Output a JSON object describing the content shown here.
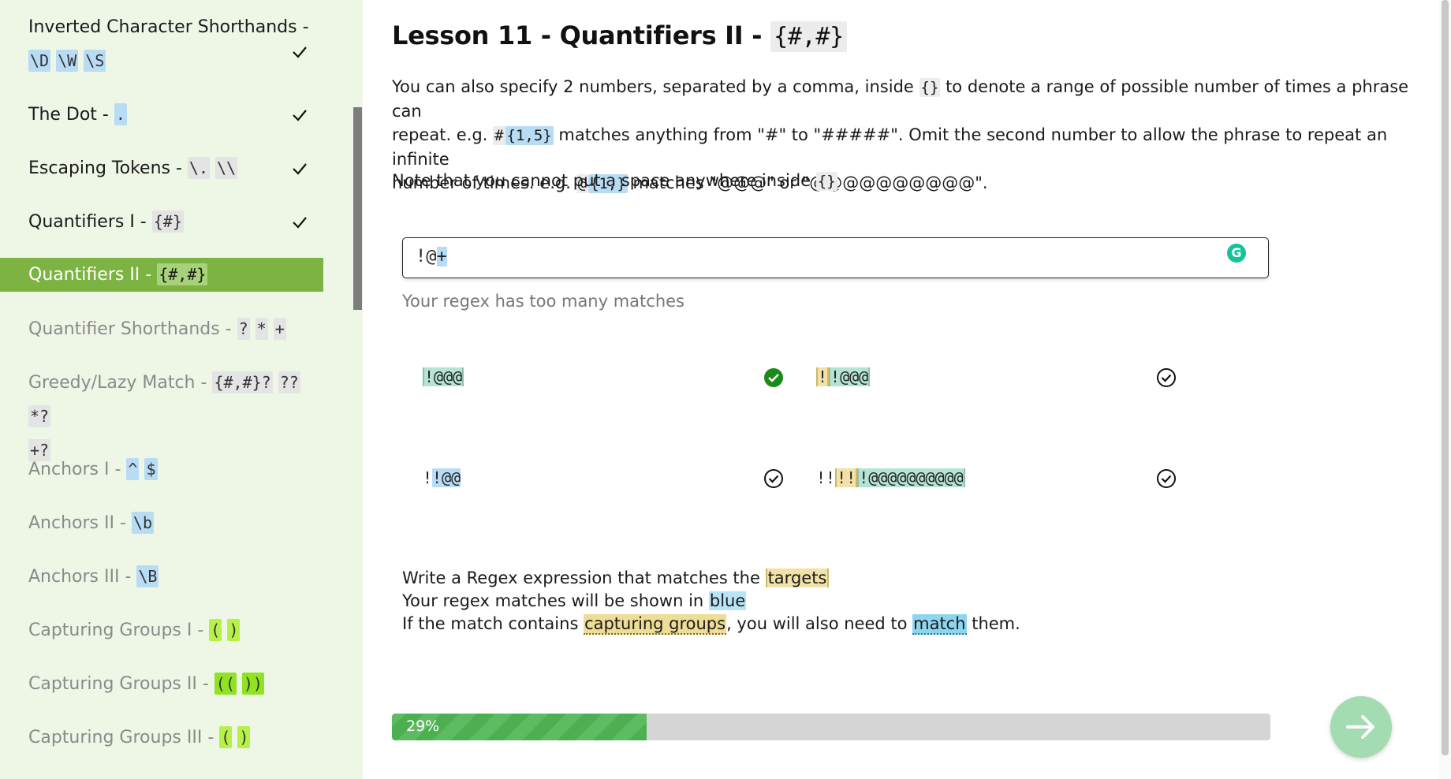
{
  "sidebar": {
    "lessons": [
      {
        "label": "Inverted Character Shorthands - ",
        "codes": [
          "\\D",
          "\\W",
          "\\S"
        ],
        "status": "done"
      },
      {
        "label": "The Dot - ",
        "codes": [
          "."
        ],
        "status": "done"
      },
      {
        "label": "Escaping Tokens - ",
        "codes": [
          "\\.",
          "\\\\"
        ],
        "status": "done"
      },
      {
        "label": "Quantifiers I - ",
        "codes": [
          "{#}"
        ],
        "status": "done"
      },
      {
        "label": "Quantifiers II - ",
        "codes": [
          "{#,#}"
        ],
        "status": "active"
      },
      {
        "label": "Quantifier Shorthands - ",
        "codes": [
          "?",
          "*",
          "+"
        ],
        "status": "todo"
      },
      {
        "label": "Greedy/Lazy Match - ",
        "codes": [
          "{#,#}?",
          "??",
          "*?",
          "+?"
        ],
        "status": "todo"
      },
      {
        "label": "Anchors I - ",
        "codes": [
          "^",
          "$"
        ],
        "status": "todo"
      },
      {
        "label": "Anchors II - ",
        "codes": [
          "\\b"
        ],
        "status": "todo"
      },
      {
        "label": "Anchors III - ",
        "codes": [
          "\\B"
        ],
        "status": "todo"
      },
      {
        "label": "Capturing Groups I - ",
        "codes": [
          "(",
          ")"
        ],
        "status": "todo"
      },
      {
        "label": "Capturing Groups II - ",
        "codes": [
          "((",
          "))"
        ],
        "status": "todo"
      },
      {
        "label": "Capturing Groups III - ",
        "codes": [
          "(",
          ")"
        ],
        "status": "todo"
      }
    ]
  },
  "lesson": {
    "title": "Lesson 11 - Quantifiers II - ",
    "title_code": "{#,#}",
    "para1": {
      "t1": "You can also specify 2 numbers, separated by a comma, inside ",
      "c1": "{}",
      "t2": " to denote a range of possible number of times a phrase can",
      "t3": "repeat. e.g. ",
      "c2a": "#",
      "c2b": "{1,5}",
      "t4": " matches anything from \"#\" to \"#####\". Omit the second number to allow the phrase to repeat an infinite",
      "t5": "number of times. e.g. ",
      "c3a": "@",
      "c3b": "{1,}",
      "t6": " matches \"@@@\" or \"@@@@@@@@@@\"."
    },
    "para2": {
      "t1": "Note that you cannot put a space anywhere inside ",
      "c1": "{}"
    }
  },
  "regex_input": {
    "value_plain": "!@",
    "value_selected": "+",
    "status": "Your regex has too many matches"
  },
  "targets": [
    {
      "pre": "",
      "yellow": "",
      "match": "!@@@",
      "status": "match-target"
    },
    {
      "pre": "",
      "yellow": "!",
      "match": "!@@@",
      "status": "ok"
    },
    {
      "pre": "!",
      "yellow": "",
      "match": "!@@",
      "status": "ok"
    },
    {
      "pre": "!!",
      "yellow": "!!",
      "match": "!@@@@@@@@@@",
      "status": "ok"
    }
  ],
  "instructions": {
    "line1_a": "Write a Regex expression that matches the ",
    "line1_b": "targets",
    "line2_a": "Your regex matches will be shown in ",
    "line2_b": "blue",
    "line3_a": "If the match contains ",
    "line3_b": "capturing groups",
    "line3_c": ", you will also need to ",
    "line3_d": "match",
    "line3_e": " them."
  },
  "progress": {
    "label": "29%",
    "fraction": 0.29
  },
  "icons": {
    "check": "check-icon",
    "next": "arrow-right-icon",
    "grammarly": "grammarly-icon"
  },
  "colors": {
    "sidebar_bg": "#eef6e6",
    "active_bg": "#7cb342",
    "progress_fill": "#4caf50",
    "next_btn": "#a3dcb0"
  }
}
